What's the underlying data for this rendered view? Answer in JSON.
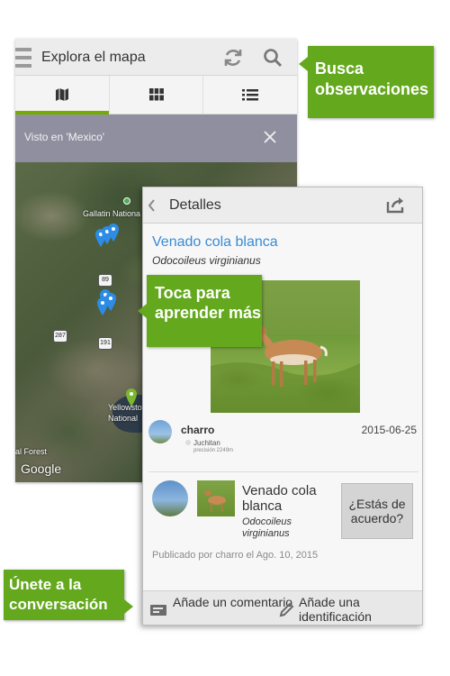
{
  "map_screen": {
    "title": "Explora el mapa",
    "tabs": [
      {
        "icon": "map-icon",
        "active": true
      },
      {
        "icon": "grid-icon",
        "active": false
      },
      {
        "icon": "list-icon",
        "active": false
      }
    ],
    "filter_text": "Visto en 'Mexico'",
    "map": {
      "labels": [
        "Gallatin Nationa",
        "Yellowsto",
        "National",
        "al Forest"
      ],
      "road_badges": [
        "89",
        "287",
        "191"
      ],
      "logo_text": "Google"
    }
  },
  "detail_screen": {
    "title": "Detalles",
    "species_common": "Venado cola blanca",
    "species_scientific": "Odocoileus virginianus",
    "observer": {
      "username": "charro",
      "date": "2015-06-25",
      "place": "Juchitan",
      "precision": "precisión 2249m"
    },
    "identification": {
      "common_name": "Venado cola blanca",
      "scientific_name": "Odocoileus virginianus",
      "agree_label": "¿Estás de acuerdo?"
    },
    "published": "Publicado por charro el Ago. 10, 2015",
    "actions": {
      "add_comment": "Añade un comentario",
      "add_identification": "Añade una identificación"
    }
  },
  "callouts": {
    "search": "Busca observaciones",
    "learn": "Toca para aprender más",
    "join": "Únete a la conversación"
  },
  "colors": {
    "accent_green": "#64a81e",
    "tab_indicator": "#74ac00",
    "link_blue": "#3a8bd6",
    "filter_bar": "#8f8fa0"
  }
}
